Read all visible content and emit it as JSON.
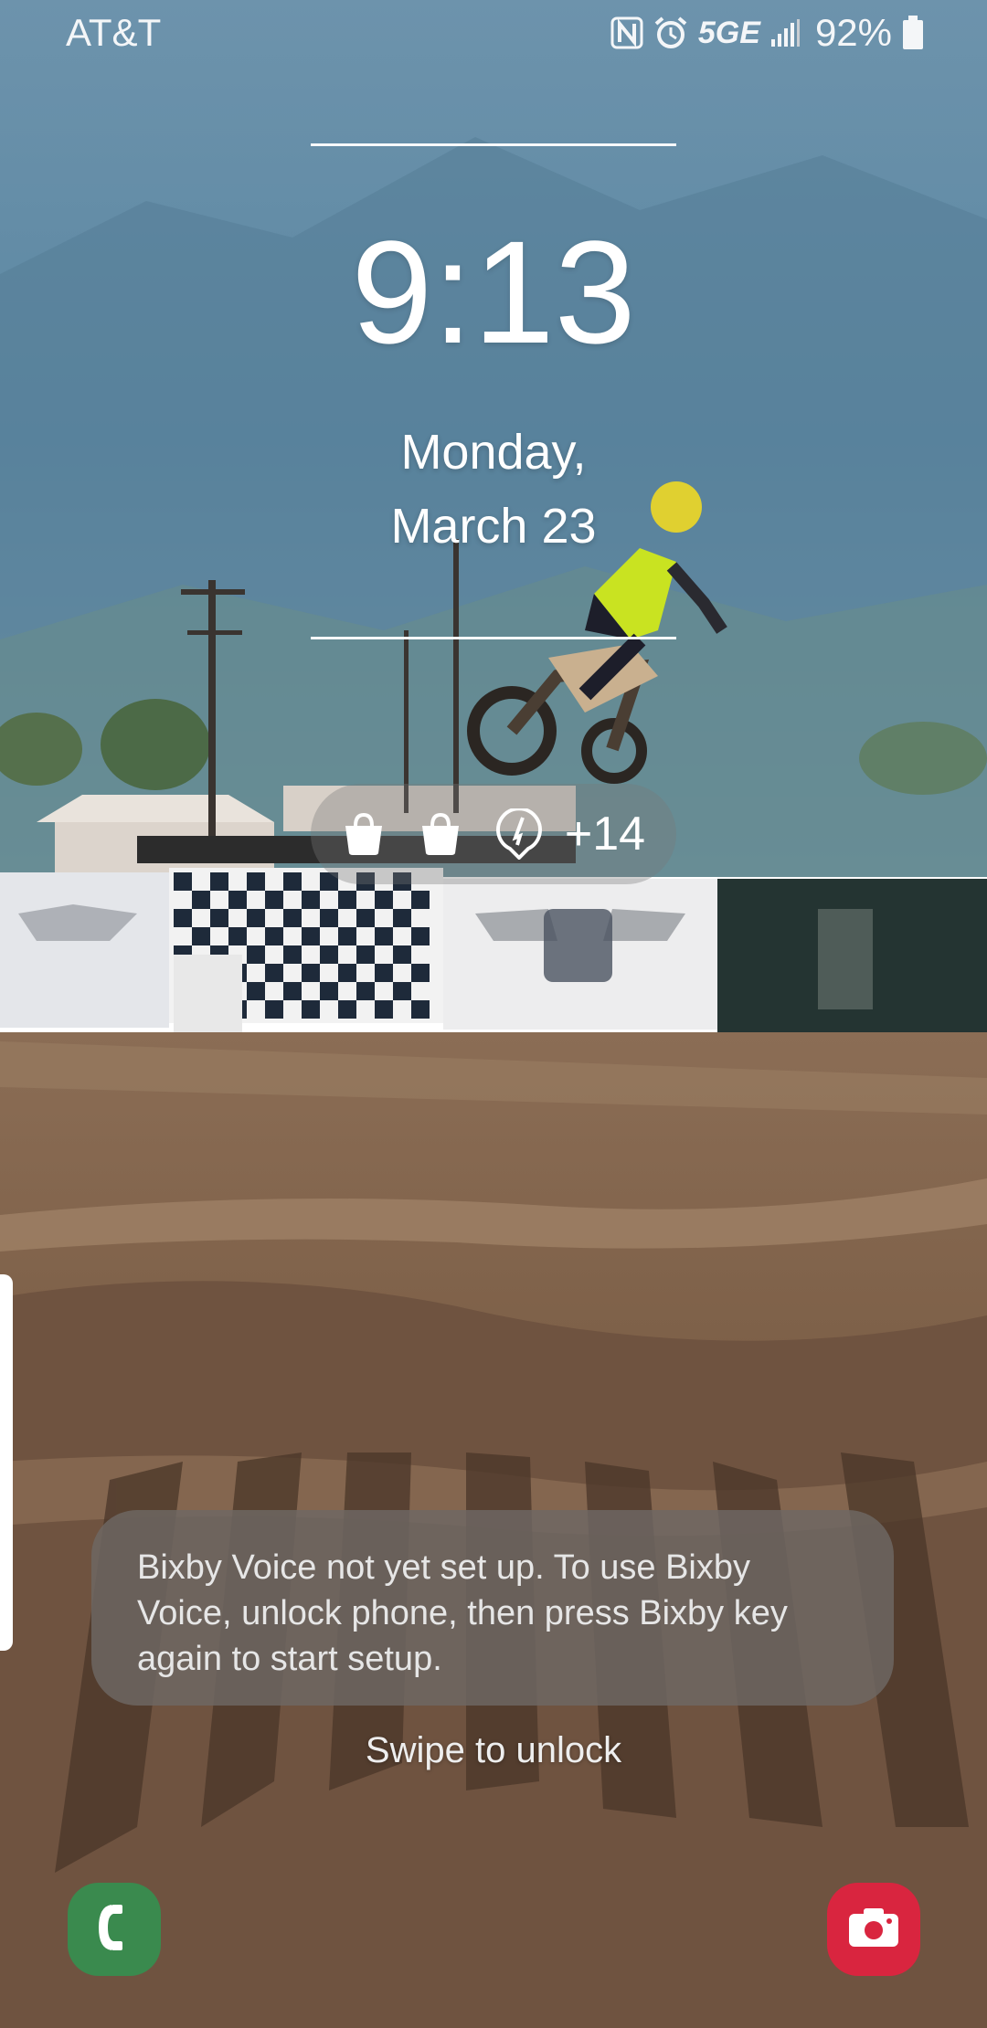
{
  "status_bar": {
    "carrier": "AT&T",
    "network_label": "5GE",
    "battery_percent": "92%",
    "icons": [
      "nfc-icon",
      "alarm-icon",
      "network-5ge-icon",
      "signal-icon",
      "battery-icon"
    ]
  },
  "lock_screen": {
    "time": "9:13",
    "date_line1": "Monday,",
    "date_line2": "March 23",
    "notification_icons": [
      "shopping-bag-icon",
      "shopping-bag-icon",
      "location-pin-icon"
    ],
    "notification_more": "+14",
    "toast_message": "Bixby Voice not yet set up. To use Bixby Voice, unlock phone, then press Bixby key again to start setup.",
    "swipe_hint": "Swipe to unlock"
  },
  "shortcuts": {
    "left": "phone-icon",
    "right": "camera-icon"
  },
  "colors": {
    "phone_shortcut": "#3a8a4e",
    "camera_shortcut": "#d9253f",
    "toast_background": "#6e6864"
  }
}
